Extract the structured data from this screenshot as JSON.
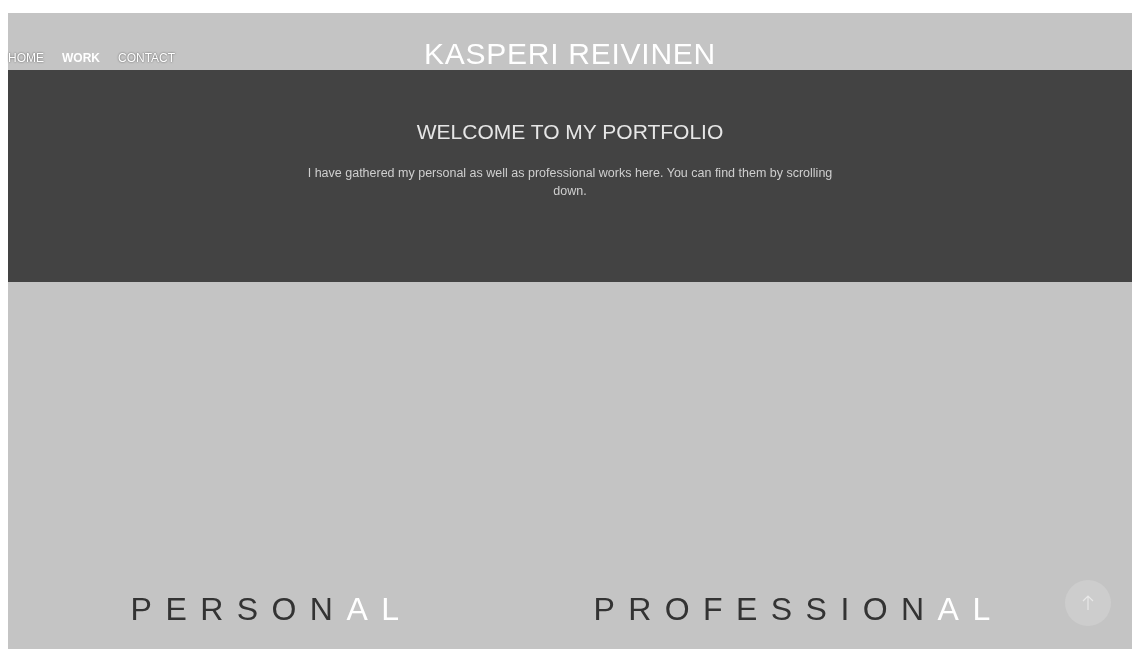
{
  "nav": [
    {
      "label": "HOME",
      "selected": false
    },
    {
      "label": "WORK",
      "selected": true
    },
    {
      "label": "CONTACT",
      "selected": false
    }
  ],
  "site_title": "KASPERI REIVINEN",
  "hero": {
    "heading": "WELCOME TO MY PORTFOLIO",
    "text": "I have gathered my personal as well as professional works here. You can find them by scrolling down."
  },
  "sections": [
    {
      "dark_part": "PERSON",
      "light_part": "AL"
    },
    {
      "dark_part": "PROFESSION",
      "light_part": "AL"
    }
  ]
}
